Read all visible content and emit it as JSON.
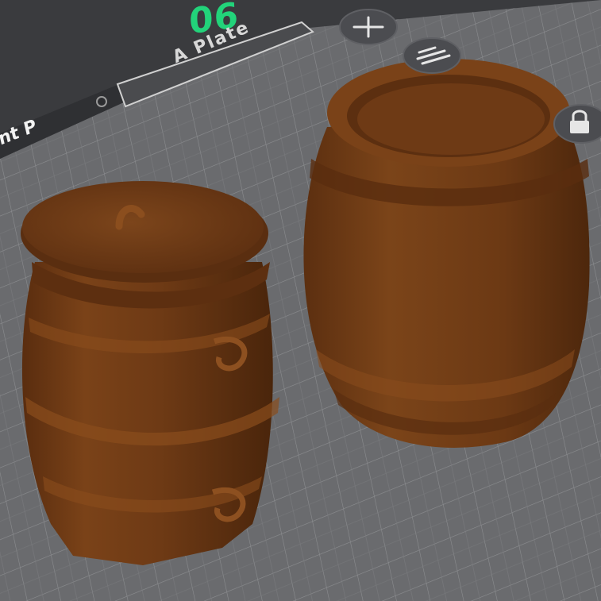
{
  "plate": {
    "number": "06",
    "name": "A Plate",
    "edge_text": "nt P"
  },
  "colors": {
    "plate_number": "#22d37a",
    "background": "#3a3b3e",
    "bed": "#6a6b6e",
    "grid_line": "#8c8d90",
    "model": "#6e3a15"
  },
  "toolbar": {
    "add_icon": "plus-icon",
    "arrange_icon": "arrange-icon",
    "lock_icon": "lock-icon"
  },
  "models": [
    "lidded-barrel",
    "open-barrel"
  ]
}
